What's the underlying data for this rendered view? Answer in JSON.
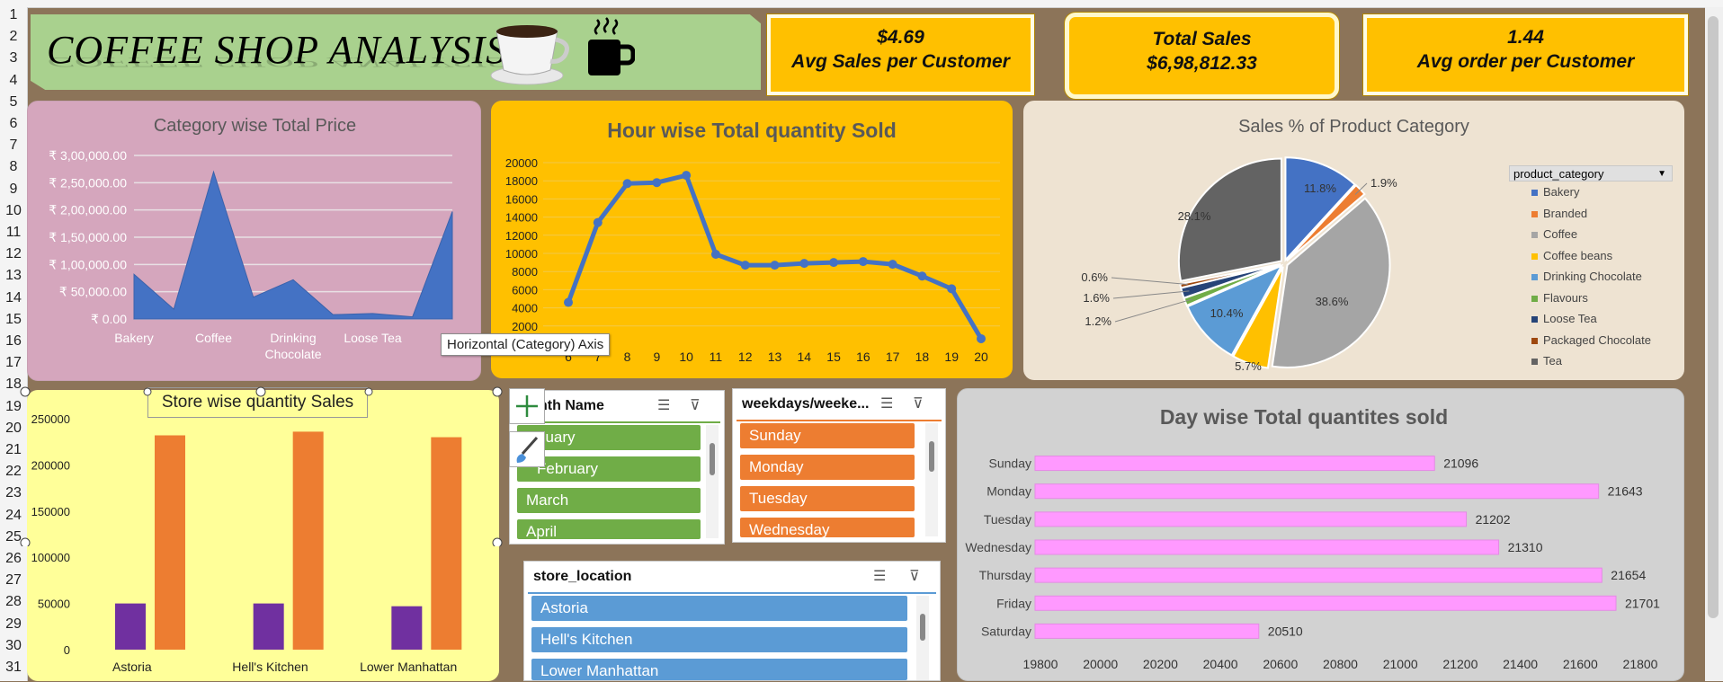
{
  "row_numbers": [
    "1",
    "2",
    "3",
    "4",
    "5",
    "6",
    "7",
    "8",
    "9",
    "10",
    "11",
    "12",
    "13",
    "14",
    "15",
    "16",
    "17",
    "18",
    "19",
    "20",
    "21",
    "22",
    "23",
    "24",
    "25",
    "26",
    "27",
    "28",
    "29",
    "30",
    "31"
  ],
  "title": "COFFEE SHOP ANALYSIS",
  "kpis": {
    "avg_sales": {
      "value": "$4.69",
      "label": "Avg Sales per Customer"
    },
    "total_sales": {
      "label": "Total Sales",
      "value": "$6,98,812.33"
    },
    "avg_order": {
      "value": "1.44",
      "label": "Avg order per Customer"
    }
  },
  "tooltip": "Horizontal (Category) Axis",
  "slicers": {
    "month": {
      "title": "Month Name",
      "title_visible": "nth Name",
      "items": [
        "January",
        "February",
        "March",
        "April"
      ],
      "items_visible": [
        "nuary",
        "February",
        "March",
        "April"
      ],
      "color": "#70ad47"
    },
    "weekday": {
      "title": "weekdays/weeke...",
      "items": [
        "Sunday",
        "Monday",
        "Tuesday",
        "Wednesday"
      ],
      "color": "#ed7d31"
    },
    "store": {
      "title": "store_location",
      "items": [
        "Astoria",
        "Hell's Kitchen",
        "Lower Manhattan"
      ],
      "color": "#5b9bd5"
    }
  },
  "colors": {
    "accent": "#ffc000",
    "cat_area": "#4472c4",
    "hour_line": "#4472c4",
    "store_bar_a": "#7030a0",
    "store_bar_b": "#ed7d31",
    "day_bar": "#ff99ff"
  },
  "chart_data": [
    {
      "id": "category",
      "type": "area",
      "title": "Category wise Total Price",
      "categories": [
        "Bakery",
        "Branded",
        "Coffee",
        "Coffee beans",
        "Drinking Chocolate",
        "Flavours",
        "Loose Tea",
        "Packaged Chocolate",
        "Tea"
      ],
      "tick_labels": [
        "Bakery",
        "Coffee",
        "Drinking Chocolate",
        "Loose Tea"
      ],
      "values": [
        82000,
        18000,
        270000,
        40000,
        72000,
        8000,
        10000,
        4000,
        197000
      ],
      "ylim": [
        0,
        300000
      ],
      "yticks": [
        "₹ 0.00",
        "₹ 50,000.00",
        "₹ 1,00,000.00",
        "₹ 1,50,000.00",
        "₹ 2,00,000.00",
        "₹ 2,50,000.00",
        "₹ 3,00,000.00"
      ]
    },
    {
      "id": "hour",
      "type": "line",
      "title": "Hour wise Total quantity Sold",
      "x": [
        6,
        7,
        8,
        9,
        10,
        11,
        12,
        13,
        14,
        15,
        16,
        17,
        18,
        19,
        20
      ],
      "values": [
        4600,
        13400,
        17700,
        17800,
        18600,
        9900,
        8700,
        8700,
        8900,
        9000,
        9100,
        8800,
        7500,
        6100,
        600
      ],
      "ylim": [
        0,
        20000
      ],
      "yticks": [
        "2000",
        "4000",
        "6000",
        "8000",
        "10000",
        "12000",
        "14000",
        "16000",
        "18000",
        "20000"
      ]
    },
    {
      "id": "pie",
      "type": "pie",
      "title": "Sales % of Product Category",
      "legend_title": "product_category",
      "slices": [
        {
          "name": "Bakery",
          "value": 11.8,
          "label": "11.8%",
          "color": "#4472c4"
        },
        {
          "name": "Branded",
          "value": 1.9,
          "label": "1.9%",
          "color": "#ed7d31"
        },
        {
          "name": "Coffee",
          "value": 38.6,
          "label": "38.6%",
          "color": "#a5a5a5"
        },
        {
          "name": "Coffee beans",
          "value": 5.7,
          "label": "5.7%",
          "color": "#ffc000"
        },
        {
          "name": "Drinking Chocolate",
          "value": 10.4,
          "label": "10.4%",
          "color": "#5b9bd5"
        },
        {
          "name": "Flavours",
          "value": 1.2,
          "label": "1.2%",
          "color": "#70ad47"
        },
        {
          "name": "Loose Tea",
          "value": 1.6,
          "label": "1.6%",
          "color": "#264478"
        },
        {
          "name": "Packaged Chocolate",
          "value": 0.6,
          "label": "0.6%",
          "color": "#9e480e"
        },
        {
          "name": "Tea",
          "value": 28.1,
          "label": "28.1%",
          "color": "#636363"
        }
      ]
    },
    {
      "id": "store",
      "type": "bar",
      "title": "Store wise quantity Sales",
      "categories": [
        "Astoria",
        "Hell's Kitchen",
        "Lower Manhattan"
      ],
      "series": [
        {
          "values": [
            50000,
            50000,
            47000
          ],
          "color": "#7030a0"
        },
        {
          "values": [
            232000,
            236000,
            230000
          ],
          "color": "#ed7d31"
        }
      ],
      "ylim": [
        0,
        250000
      ],
      "yticks": [
        "0",
        "50000",
        "100000",
        "150000",
        "200000",
        "250000"
      ]
    },
    {
      "id": "day",
      "type": "bar",
      "orientation": "horizontal",
      "title": "Day wise Total quantites sold",
      "categories": [
        "Sunday",
        "Monday",
        "Tuesday",
        "Wednesday",
        "Thursday",
        "Friday",
        "Saturday"
      ],
      "values": [
        21096,
        21643,
        21202,
        21310,
        21654,
        21701,
        20510
      ],
      "data_labels": [
        "21096",
        "21643",
        "21202",
        "21310",
        "21654",
        "21701",
        "20510"
      ],
      "xlim": [
        19800,
        21800
      ],
      "xticks": [
        "19800",
        "20000",
        "20200",
        "20400",
        "20600",
        "20800",
        "21000",
        "21200",
        "21400",
        "21600",
        "21800"
      ]
    }
  ]
}
